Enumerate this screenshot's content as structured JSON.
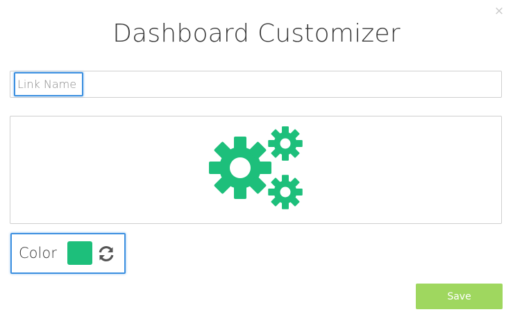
{
  "modal": {
    "title": "Dashboard Customizer",
    "close_glyph": "×"
  },
  "link_name": {
    "placeholder": "Link Name",
    "value": ""
  },
  "preview": {
    "icon": "gears-icon"
  },
  "color": {
    "label": "Color",
    "selected": "#1dbf7b",
    "refresh_icon": "refresh-icon"
  },
  "actions": {
    "save_label": "Save",
    "save_color": "#9fd75f"
  },
  "colors": {
    "accent": "#1dbf7b",
    "highlight": "#3b8fe0"
  }
}
